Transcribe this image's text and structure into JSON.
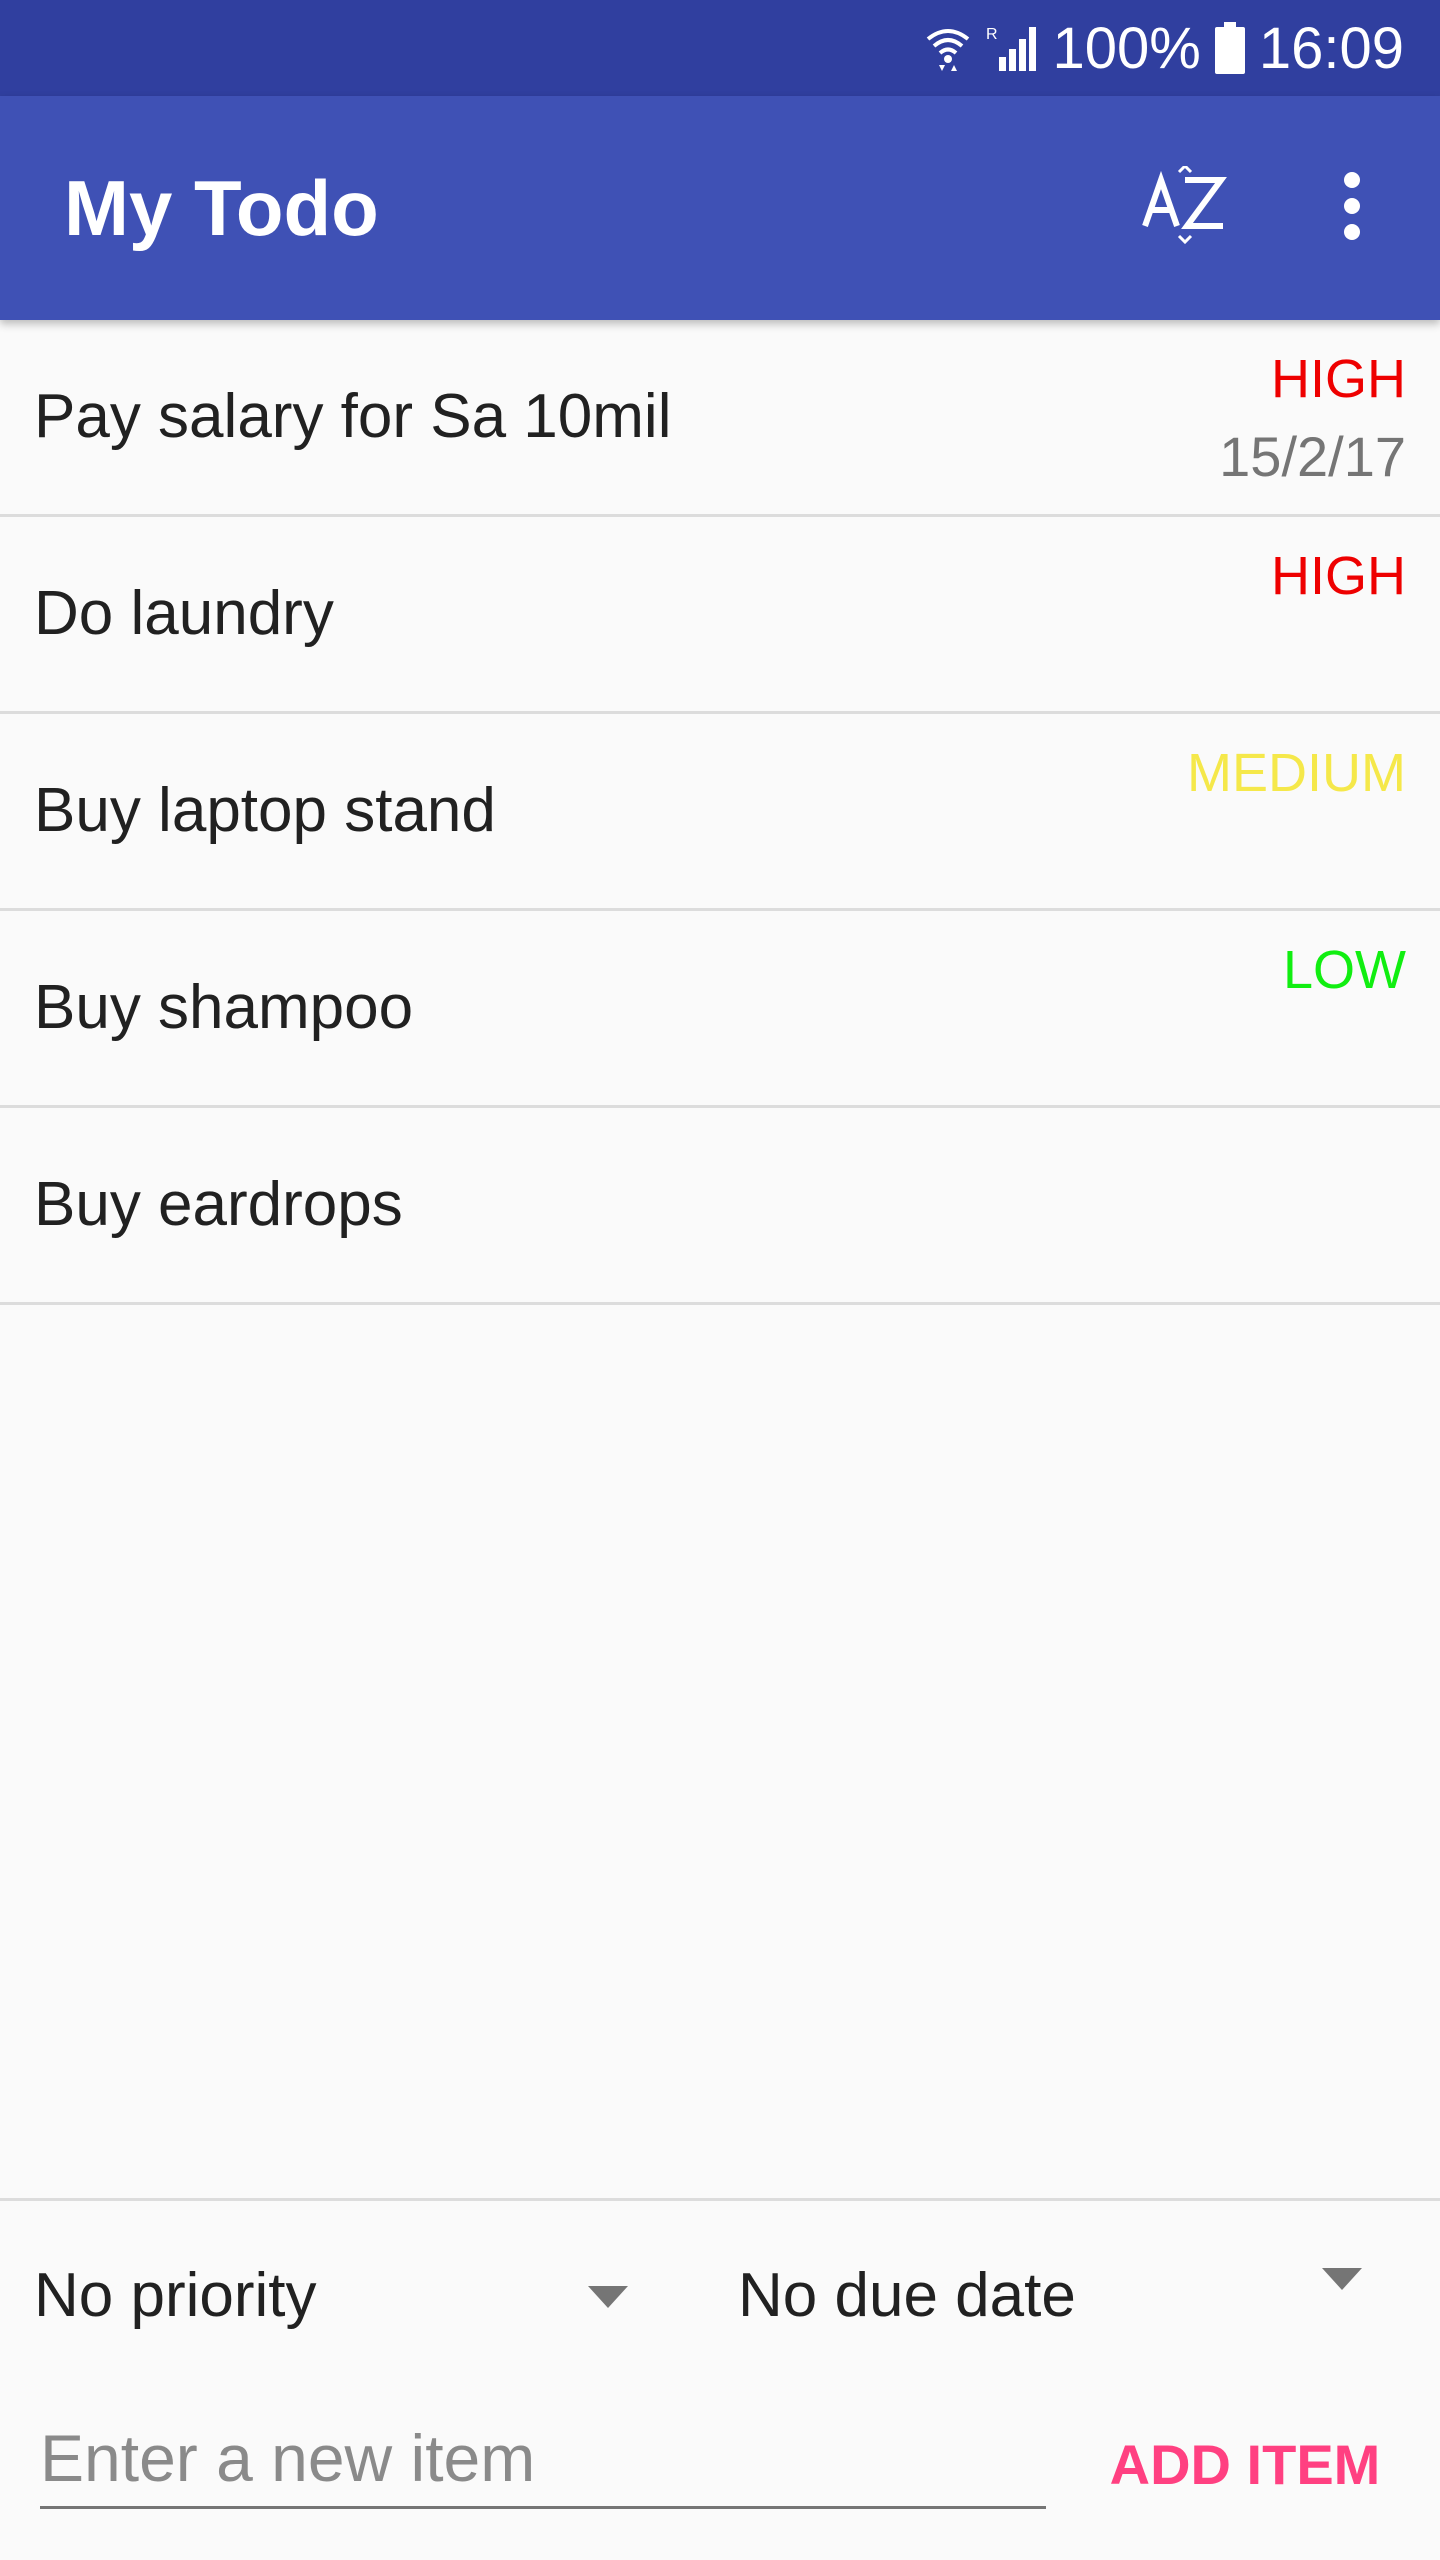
{
  "status_bar": {
    "battery_text": "100%",
    "time": "16:09",
    "icons": [
      "wifi-icon",
      "signal-icon",
      "battery-icon"
    ]
  },
  "app_bar": {
    "title": "My Todo",
    "sort_icon": "sort-az-icon",
    "menu_icon": "more-vert-icon"
  },
  "colors": {
    "primary_dark": "#303f9f",
    "primary": "#3f51b5",
    "accent": "#ff4081",
    "priority_high": "#ee0000",
    "priority_medium": "#f5e84a",
    "priority_low": "#11ee11"
  },
  "todos": [
    {
      "text": "Pay salary for Sa 10mil",
      "priority": "HIGH",
      "due": "15/2/17"
    },
    {
      "text": "Do laundry",
      "priority": "HIGH",
      "due": ""
    },
    {
      "text": "Buy laptop stand",
      "priority": "MEDIUM",
      "due": ""
    },
    {
      "text": "Buy shampoo",
      "priority": "LOW",
      "due": ""
    },
    {
      "text": "Buy eardrops",
      "priority": "",
      "due": ""
    }
  ],
  "form": {
    "priority_selected": "No priority",
    "due_selected": "No due date",
    "input_placeholder": "Enter a new item",
    "input_value": "",
    "add_label": "ADD ITEM"
  }
}
